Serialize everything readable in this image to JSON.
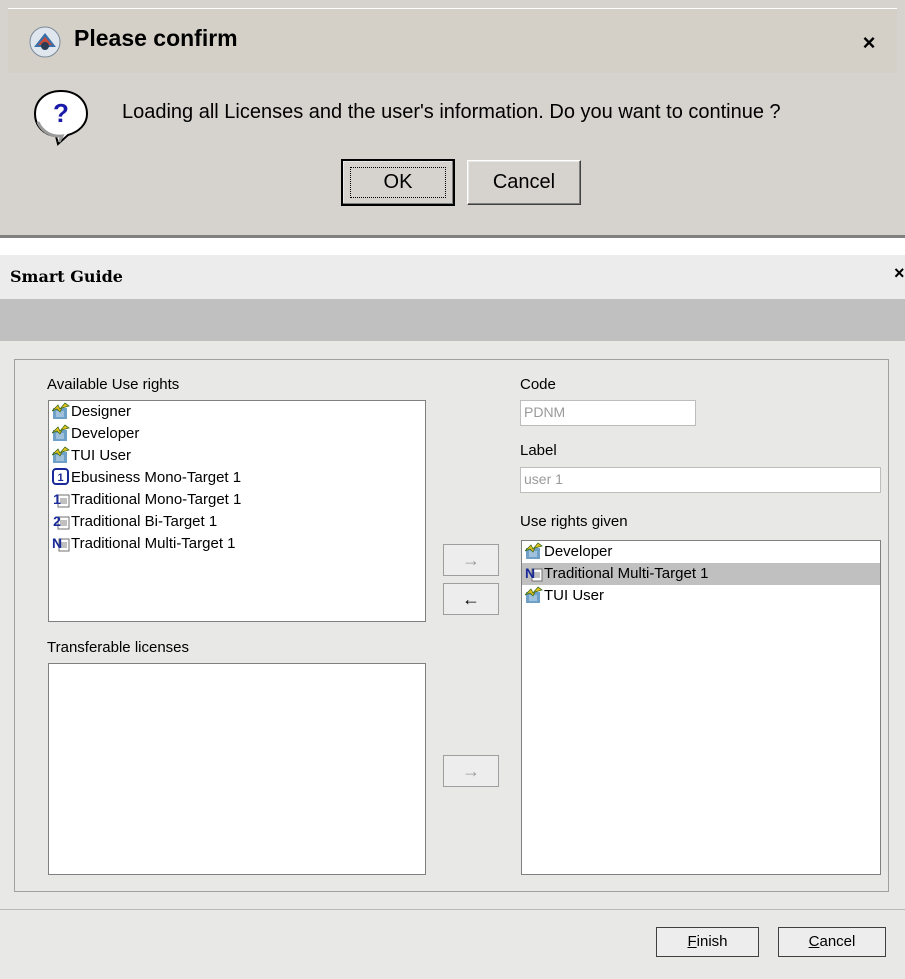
{
  "confirm": {
    "title": "Please confirm",
    "message": "Loading all Licenses and the user's information. Do you want to continue ?",
    "ok_label": "OK",
    "cancel_label": "Cancel",
    "close_glyph": "×"
  },
  "guide": {
    "title": "Smart Guide",
    "close_glyph": "×",
    "available_label": "Available Use rights",
    "available_items": [
      {
        "label": "Designer",
        "icon": "user-right-icon"
      },
      {
        "label": "Developer",
        "icon": "user-right-icon"
      },
      {
        "label": "TUI User",
        "icon": "user-right-icon"
      },
      {
        "label": "Ebusiness Mono-Target 1",
        "icon": "ebusiness-1-icon"
      },
      {
        "label": "Traditional Mono-Target 1",
        "icon": "target-1-icon"
      },
      {
        "label": "Traditional Bi-Target 1",
        "icon": "target-2-icon"
      },
      {
        "label": "Traditional Multi-Target 1",
        "icon": "target-n-icon"
      }
    ],
    "transferable_label": "Transferable licenses",
    "code_label": "Code",
    "code_value": "PDNM",
    "label_label": "Label",
    "label_value": "user 1",
    "given_label": "Use rights given",
    "given_items": [
      {
        "label": "Developer",
        "icon": "user-right-icon",
        "selected": false
      },
      {
        "label": "Traditional Multi-Target 1",
        "icon": "target-n-icon",
        "selected": true
      },
      {
        "label": "TUI User",
        "icon": "user-right-icon",
        "selected": false
      }
    ],
    "arrow_right": "→",
    "arrow_left": "←",
    "finish_mnemonic": "F",
    "finish_rest": "inish",
    "cancel_mnemonic": "C",
    "cancel_rest": "ancel"
  }
}
